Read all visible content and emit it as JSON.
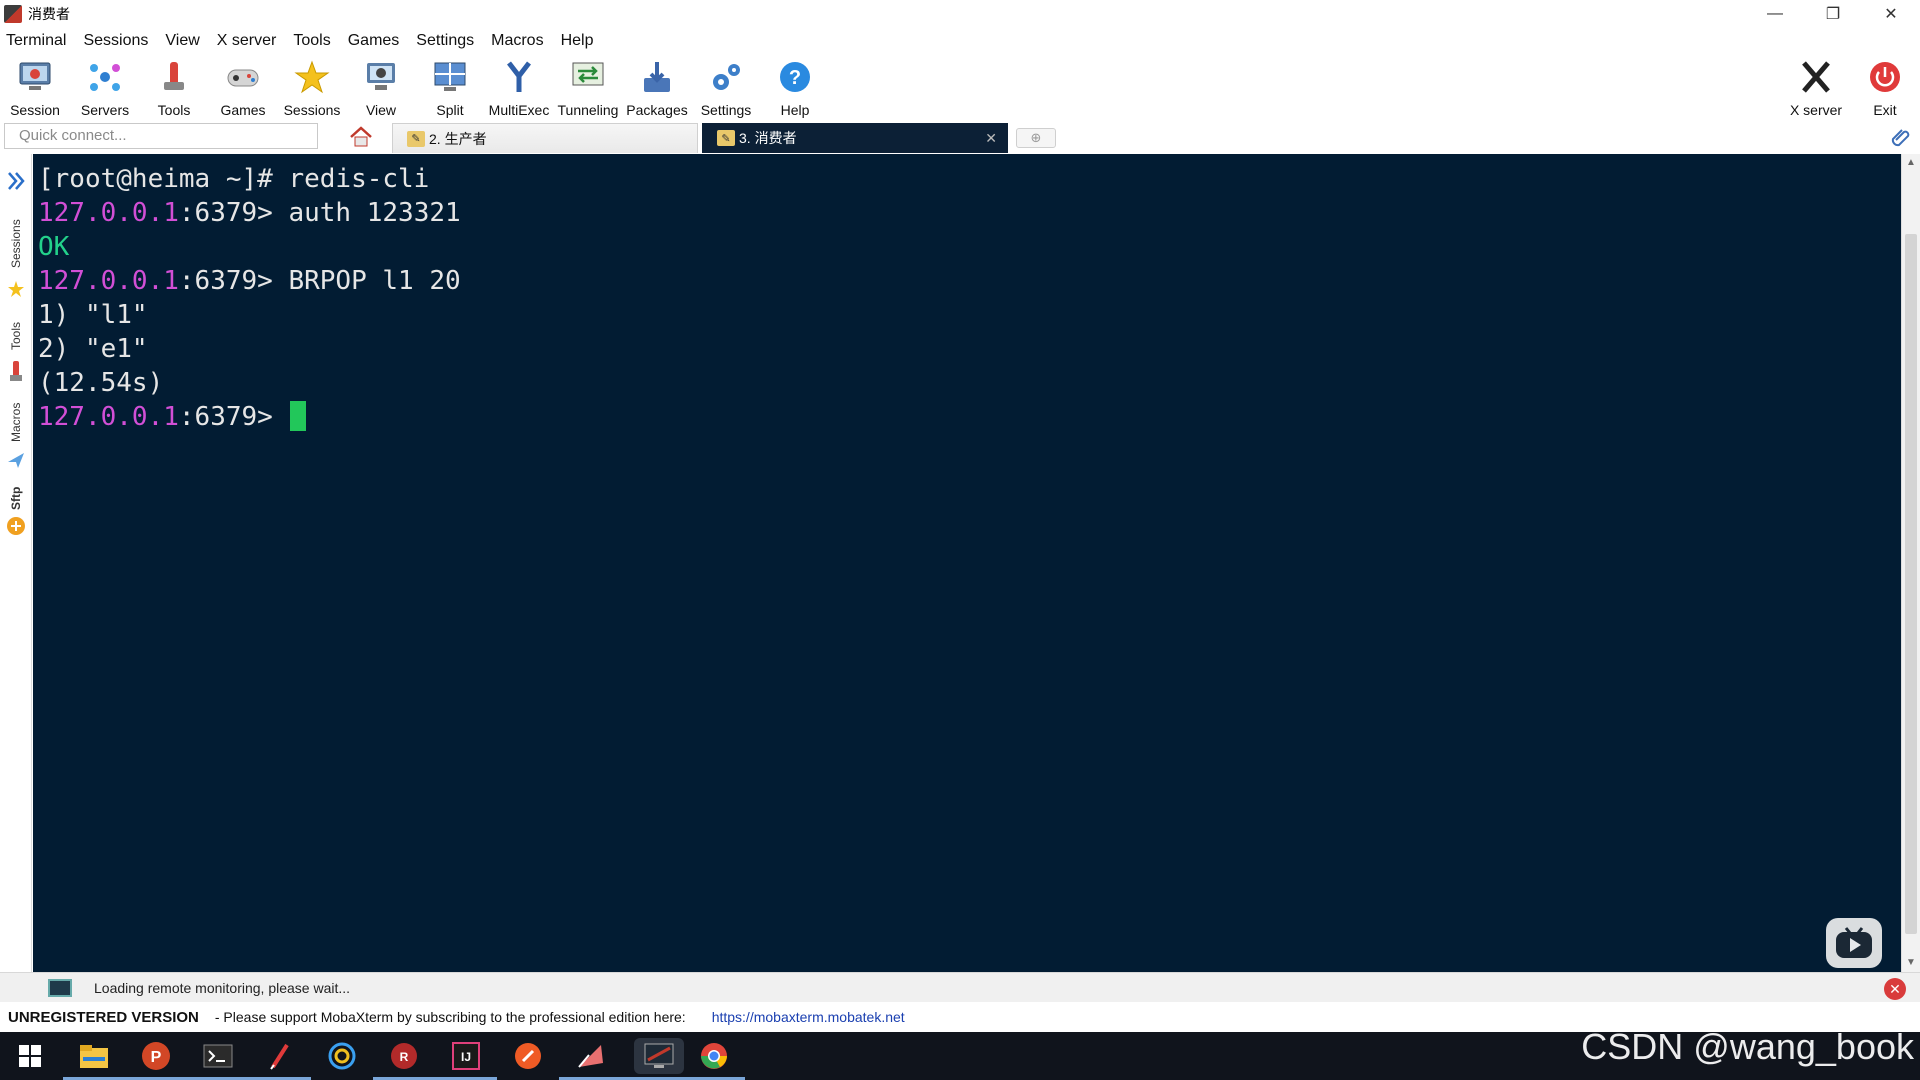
{
  "window": {
    "title": "消费者",
    "controls": [
      "—",
      "❐",
      "✕"
    ]
  },
  "menu": [
    "Terminal",
    "Sessions",
    "View",
    "X server",
    "Tools",
    "Games",
    "Settings",
    "Macros",
    "Help"
  ],
  "toolbar": {
    "left": [
      "Session",
      "Servers",
      "Tools",
      "Games",
      "Sessions",
      "View",
      "Split",
      "MultiExec",
      "Tunneling",
      "Packages",
      "Settings",
      "Help"
    ],
    "right": [
      "X server",
      "Exit"
    ]
  },
  "quick_connect": {
    "placeholder": "Quick connect..."
  },
  "tabs": [
    {
      "label": "2. 生产者",
      "active": false
    },
    {
      "label": "3. 消费者",
      "active": true
    }
  ],
  "side": {
    "sessions": "Sessions",
    "tools": "Tools",
    "macros": "Macros",
    "sftp": "Sftp"
  },
  "terminal": {
    "l1": "[root@heima ~]# redis-cli",
    "ip": "127.0.0.1",
    "port": ":6379> ",
    "cmd2": "auth 123321",
    "ok": "OK",
    "cmd4": "BRPOP l1 20",
    "r1": "1) \"l1\"",
    "r2": "2) \"e1\"",
    "time": "(12.54s)"
  },
  "status": {
    "monitor": "Loading remote monitoring, please wait...",
    "unregistered": "UNREGISTERED VERSION",
    "message": "-  Please support MobaXterm by subscribing to the professional edition here:",
    "link": "https://mobaxterm.mobatek.net"
  },
  "watermark": "CSDN @wang_book",
  "taskbar_icons": [
    "windows-start-icon",
    "file-explorer-icon",
    "powerpoint-icon",
    "terminal-icon",
    "pen-icon",
    "browser-icon",
    "redis-desktop-icon",
    "intellij-icon",
    "postman-icon",
    "typora-icon",
    "mobaxterm-icon",
    "chrome-icon"
  ],
  "colors": {
    "terminal_bg": "#021c33",
    "prompt_ip": "#d24fd6",
    "ok_green": "#23d18b",
    "cursor": "#22c75a"
  }
}
